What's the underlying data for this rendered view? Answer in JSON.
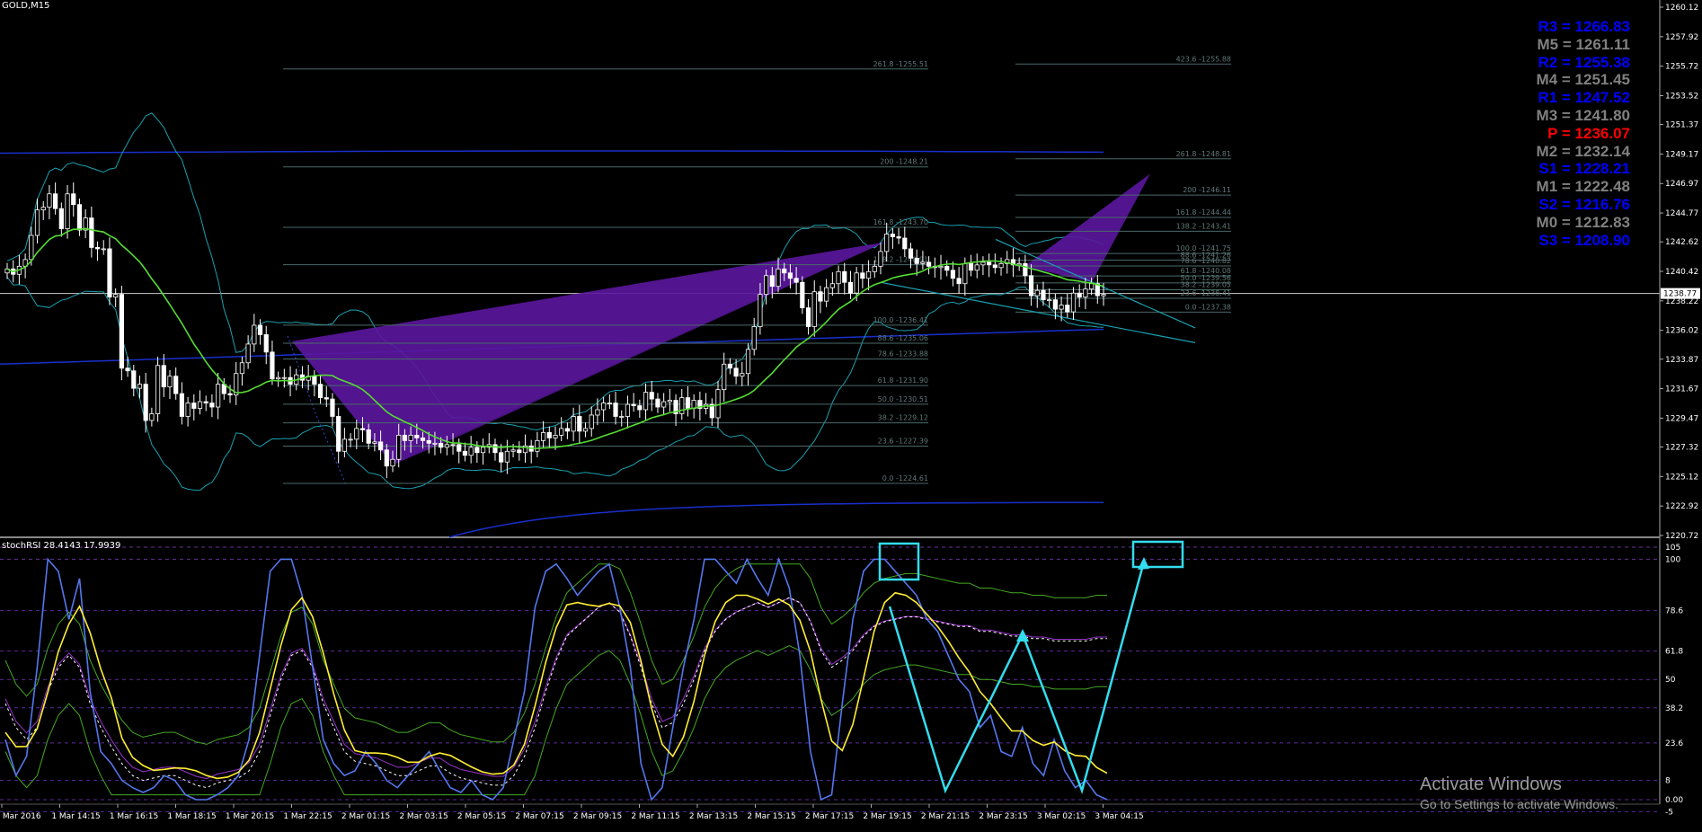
{
  "symbol": "GOLD,M15",
  "indicator_label": "stochRSI 28.4143 17.9939",
  "watermark": {
    "title": "Activate Windows",
    "subtitle": "Go to Settings to activate Windows."
  },
  "pivots": [
    {
      "label": "R3 = 1266.83",
      "color": "#0000ff"
    },
    {
      "label": "M5 = 1261.11",
      "color": "#808080"
    },
    {
      "label": "R2 = 1255.38",
      "color": "#0000ff"
    },
    {
      "label": "M4 = 1251.45",
      "color": "#808080"
    },
    {
      "label": "R1 = 1247.52",
      "color": "#0000ff"
    },
    {
      "label": "M3 = 1241.80",
      "color": "#808080"
    },
    {
      "label": "P  = 1236.07",
      "color": "#ff0000"
    },
    {
      "label": "M2 = 1232.14",
      "color": "#808080"
    },
    {
      "label": "S1 = 1228.21",
      "color": "#0000ff"
    },
    {
      "label": "M1 = 1222.48",
      "color": "#808080"
    },
    {
      "label": "S2 = 1216.76",
      "color": "#0000ff"
    },
    {
      "label": "M0 = 1212.83",
      "color": "#808080"
    },
    {
      "label": "S3 = 1208.90",
      "color": "#0000ff"
    }
  ],
  "colors": {
    "background": "#000000",
    "candle": "#ffffff",
    "ma_green": "#55dd33",
    "bollinger": "#1aa0b0",
    "envelope": "#1a2fcc",
    "harmonic": "#5b169e",
    "fib": "#4a6a68",
    "stoch_blue": "#5577ee",
    "stoch_yellow": "#ffee33",
    "annotation": "#33ddee",
    "current_price": "#cccccc"
  },
  "chart_data": [
    {
      "type": "candlestick",
      "title": "GOLD,M15",
      "ylim": [
        1220.72,
        1260.12
      ],
      "y_ticks": [
        "1260.12",
        "1257.92",
        "1255.72",
        "1253.52",
        "1251.37",
        "1249.17",
        "1246.97",
        "1244.77",
        "1242.62",
        "1240.42",
        "1238.22",
        "1236.02",
        "1233.87",
        "1231.67",
        "1229.47",
        "1227.32",
        "1225.12",
        "1222.92",
        "1220.72"
      ],
      "current_price": "1238.77",
      "x_ticks": [
        "1 Mar 2016",
        "1 Mar 14:15",
        "1 Mar 16:15",
        "1 Mar 18:15",
        "1 Mar 20:15",
        "1 Mar 22:15",
        "2 Mar 01:15",
        "2 Mar 03:15",
        "2 Mar 05:15",
        "2 Mar 07:15",
        "2 Mar 09:15",
        "2 Mar 11:15",
        "2 Mar 13:15",
        "2 Mar 15:15",
        "2 Mar 17:15",
        "2 Mar 19:15",
        "2 Mar 21:15",
        "2 Mar 23:15",
        "3 Mar 02:15",
        "3 Mar 04:15"
      ],
      "close": [
        1240.6,
        1240.2,
        1240.8,
        1241.3,
        1243.1,
        1245.0,
        1245.2,
        1246.2,
        1245.1,
        1243.6,
        1246.2,
        1245.4,
        1243.5,
        1244.4,
        1242.2,
        1242.1,
        1242.1,
        1238.5,
        1238.7,
        1233.2,
        1233.0,
        1231.7,
        1232.0,
        1229.3,
        1229.8,
        1233.4,
        1231.8,
        1232.6,
        1231.3,
        1229.6,
        1230.6,
        1230.2,
        1230.7,
        1230.6,
        1230.3,
        1232.0,
        1231.3,
        1231.2,
        1232.8,
        1233.6,
        1235.0,
        1236.4,
        1235.7,
        1234.4,
        1232.4,
        1232.5,
        1232.5,
        1232.0,
        1232.7,
        1232.3,
        1232.6,
        1232.0,
        1231.0,
        1230.9,
        1229.6,
        1227.0,
        1227.9,
        1227.9,
        1228.7,
        1228.6,
        1227.6,
        1227.7,
        1227.1,
        1225.9,
        1226.4,
        1228.2,
        1227.8,
        1228.2,
        1228.0,
        1227.8,
        1227.6,
        1227.6,
        1227.3,
        1227.5,
        1227.5,
        1227.0,
        1226.7,
        1227.3,
        1226.9,
        1227.3,
        1227.5,
        1226.9,
        1226.2,
        1227.0,
        1227.1,
        1226.9,
        1227.4,
        1227.0,
        1227.8,
        1228.4,
        1228.0,
        1228.2,
        1228.7,
        1228.5,
        1229.6,
        1228.5,
        1228.7,
        1229.7,
        1230.1,
        1230.6,
        1230.6,
        1229.6,
        1229.6,
        1230.5,
        1230.4,
        1230.1,
        1231.4,
        1230.9,
        1230.3,
        1230.7,
        1230.8,
        1229.8,
        1231.0,
        1230.2,
        1230.8,
        1230.2,
        1230.5,
        1229.5,
        1231.6,
        1233.5,
        1233.2,
        1232.6,
        1232.8,
        1234.6,
        1236.3,
        1238.7,
        1240.1,
        1239.3,
        1240.6,
        1240.3,
        1239.9,
        1239.6,
        1237.7,
        1236.3,
        1238.9,
        1238.2,
        1239.2,
        1239.5,
        1240.4,
        1239.6,
        1238.8,
        1240.3,
        1239.9,
        1240.4,
        1240.8,
        1241.9,
        1243.2,
        1243.0,
        1242.9,
        1242.1,
        1241.4,
        1241.0,
        1241.1,
        1240.8,
        1240.7,
        1240.8,
        1240.5,
        1239.9,
        1239.5,
        1241.0,
        1240.5,
        1240.9,
        1241.1,
        1240.9,
        1240.7,
        1241.0,
        1241.3,
        1240.9,
        1241.0,
        1240.1,
        1238.6,
        1239.0,
        1238.3,
        1238.3,
        1237.6,
        1237.9,
        1237.4,
        1238.8,
        1238.5,
        1239.1,
        1239.5,
        1238.6,
        1238.7
      ],
      "fib_levels": [
        "261.8 -1255.51",
        "200 -1248.21",
        "161.8 -1243.70",
        "138.2 -1240.91",
        "100.0 -1236.41",
        "88.6 -1235.06",
        "78.6 -1233.88",
        "61.8 -1231.90",
        "50.0 -1230.51",
        "38.2 -1229.12",
        "23.6 -1227.39",
        "0.0 -1224.61",
        "423.6 -1255.88",
        "261.8 -1248.81",
        "200 -1246.11",
        "161.8 -1244.44",
        "138.2 -1243.41",
        "100.0 -1241.75",
        "88.6 -1241.26",
        "78.6 -1240.82",
        "61.8 -1240.08",
        "50.0 -1239.56",
        "38.2 -1239.05",
        "23.6 -1238.41",
        "0.0 -1237.38"
      ],
      "grid": false
    },
    {
      "type": "line",
      "title": "stochRSI 28.4143 17.9939",
      "ylim": [
        0,
        105
      ],
      "y_ticks": [
        "105",
        "100",
        "78.6",
        "61.8",
        "50",
        "38.2",
        "23.6",
        "8",
        "0.00",
        "-5"
      ],
      "x_ticks": [
        "1 Mar 2016",
        "1 Mar 14:15",
        "1 Mar 16:15",
        "1 Mar 18:15",
        "1 Mar 20:15",
        "1 Mar 22:15",
        "2 Mar 01:15",
        "2 Mar 03:15",
        "2 Mar 05:15",
        "2 Mar 07:15",
        "2 Mar 09:15",
        "2 Mar 11:15",
        "2 Mar 13:15",
        "2 Mar 15:15",
        "2 Mar 17:15",
        "2 Mar 19:15",
        "2 Mar 21:15",
        "2 Mar 23:15",
        "3 Mar 02:15",
        "3 Mar 04:15"
      ],
      "series": [
        {
          "values": [
            25,
            10,
            18,
            55,
            100,
            95,
            75,
            92,
            45,
            20,
            15,
            8,
            5,
            3,
            5,
            10,
            8,
            2,
            0,
            0,
            2,
            5,
            10,
            25,
            60,
            95,
            100,
            100,
            85,
            55,
            25,
            15,
            10,
            12,
            20,
            15,
            8,
            5,
            10,
            15,
            20,
            12,
            5,
            3,
            8,
            2,
            0,
            5,
            25,
            45,
            80,
            95,
            98,
            92,
            85,
            90,
            95,
            98,
            80,
            55,
            15,
            0,
            5,
            30,
            55,
            75,
            100,
            100,
            95,
            90,
            100,
            92,
            85,
            100,
            88,
            60,
            20,
            0,
            2,
            40,
            75,
            95,
            100,
            100,
            95,
            90,
            85,
            75,
            70,
            60,
            50,
            45,
            30,
            35,
            20,
            18,
            30,
            15,
            10,
            25,
            12,
            5,
            8,
            2,
            0
          ]
        },
        {
          "values": [
            40,
            30,
            25,
            30,
            45,
            55,
            60,
            55,
            40,
            30,
            22,
            15,
            10,
            8,
            9,
            10,
            10,
            8,
            6,
            5,
            7,
            8,
            9,
            12,
            20,
            35,
            50,
            60,
            62,
            55,
            40,
            30,
            20,
            16,
            15,
            14,
            12,
            10,
            10,
            12,
            14,
            14,
            11,
            9,
            8,
            7,
            6,
            6,
            10,
            18,
            30,
            45,
            58,
            68,
            72,
            76,
            80,
            82,
            78,
            68,
            55,
            40,
            30,
            32,
            40,
            50,
            62,
            70,
            75,
            78,
            80,
            82,
            80,
            82,
            84,
            82,
            74,
            62,
            55,
            58,
            62,
            68,
            72,
            74,
            75,
            76,
            76,
            75,
            74,
            73,
            72,
            72,
            70,
            70,
            69,
            68,
            68,
            67,
            67,
            66,
            66,
            66,
            66,
            67,
            67
          ]
        }
      ],
      "levels": [
        105,
        100,
        78.6,
        61.8,
        50,
        38.2,
        23.6,
        8,
        0,
        -5
      ],
      "grid": true
    }
  ]
}
